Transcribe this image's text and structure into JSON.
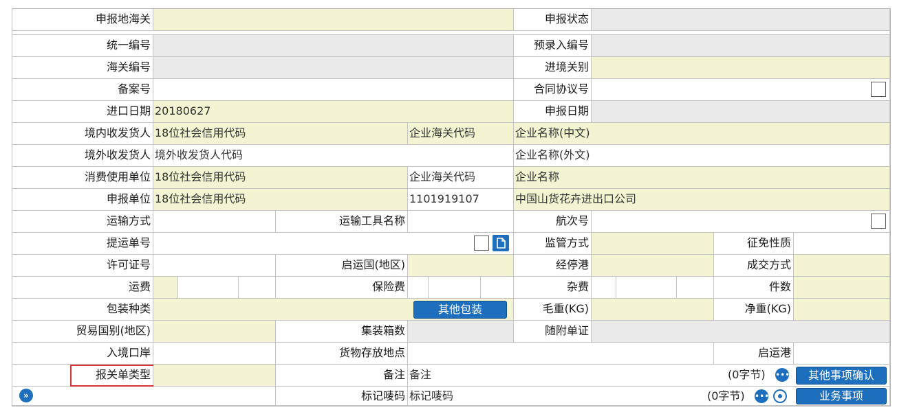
{
  "labels": {
    "customs_office": "申报地海关",
    "declare_status": "申报状态",
    "unified_no": "统一编号",
    "pre_entry_no": "预录入编号",
    "customs_no": "海关编号",
    "entry_customs": "进境关别",
    "record_no": "备案号",
    "contract_no": "合同协议号",
    "import_date": "进口日期",
    "declare_date": "申报日期",
    "domestic_consignee": "境内收发货人",
    "enterprise_customs_code": "企业海关代码",
    "foreign_consignor": "境外收发货人",
    "consumer_unit": "消费使用单位",
    "declaring_unit": "申报单位",
    "transport_mode": "运输方式",
    "vehicle_name": "运输工具名称",
    "voyage_no": "航次号",
    "bill_no": "提运单号",
    "supervision_mode": "监管方式",
    "levy_nature": "征免性质",
    "license_no": "许可证号",
    "departure_country": "启运国(地区)",
    "stop_port": "经停港",
    "deal_mode": "成交方式",
    "freight": "运费",
    "insurance": "保险费",
    "misc_fee": "杂费",
    "pieces": "件数",
    "package_type": "包装种类",
    "gross_weight": "毛重(KG)",
    "net_weight": "净重(KG)",
    "trade_country": "贸易国别(地区)",
    "container_count": "集装箱数",
    "attached_docs": "随附单证",
    "entry_port": "入境口岸",
    "storage_place": "货物存放地点",
    "departure_port": "启运港",
    "declaration_type": "报关单类型",
    "remark": "备注",
    "marks": "标记唛码"
  },
  "values": {
    "import_date": "20180627",
    "domestic_credit_ph": "18位社会信用代码",
    "enterprise_cn_ph": "企业名称(中文)",
    "foreign_code_ph": "境外收发货人代码",
    "enterprise_foreign_ph": "企业名称(外文)",
    "consumer_credit_ph": "18位社会信用代码",
    "enterprise_name_ph": "企业名称",
    "declaring_credit_ph": "18位社会信用代码",
    "declaring_customs_code": "1101919107",
    "declaring_name": "中国山货花卉进出口公司",
    "remark_ph": "备注",
    "marks_ph": "标记唛码"
  },
  "counters": {
    "remark_bytes": "(0字节)",
    "marks_bytes": "(0字节)"
  },
  "buttons": {
    "other_packaging": "其他包装",
    "other_confirm": "其他事项确认",
    "business_items": "业务事项"
  },
  "colors": {
    "required_field": "#f5f4d2",
    "readonly_field": "#eaeaea",
    "button_blue": "#1d6fbd",
    "highlight_red": "#d8333a"
  }
}
